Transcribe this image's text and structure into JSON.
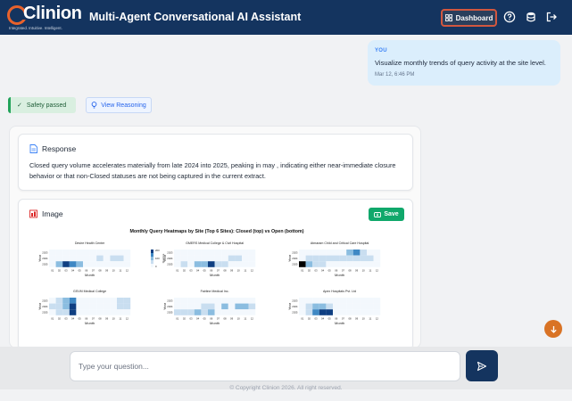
{
  "header": {
    "logo_text": "Clinion",
    "logo_tagline": "Integrated. Intuitive. Intelligent.",
    "title": "Multi-Agent Conversational AI Assistant",
    "dashboard_label": "Dashboard",
    "icons": [
      "help-icon",
      "database-icon",
      "logout-icon"
    ]
  },
  "user_message": {
    "label": "YOU",
    "text": "Visualize monthly trends of query activity at the site level.",
    "timestamp": "Mar 12, 6:46 PM"
  },
  "status": {
    "safety_label": "Safety passed",
    "reasoning_label": "View Reasoning"
  },
  "response": {
    "title": "Response",
    "body": "Closed query volume accelerates materially from late 2024 into 2025, peaking in may , indicating either near-immediate closure behavior or that non-Closed statuses are not being captured in the current extract."
  },
  "image_card": {
    "title": "Image",
    "save_label": "Save"
  },
  "chart_data": {
    "type": "heatmap",
    "title": "Monthly Query Heatmaps by Site (Top 6 Sites): Closed (top) vs Open (bottom)",
    "xlabel": "Month",
    "ylabel": "Year",
    "colorbar_label": "Queries",
    "colorbar_ticks": [
      "200",
      "100",
      "0"
    ],
    "months": [
      "01",
      "02",
      "03",
      "04",
      "05",
      "06",
      "07",
      "08",
      "09",
      "10",
      "11",
      "12"
    ],
    "years": [
      "2023",
      "2024",
      "2025"
    ],
    "panels": [
      {
        "name": "Desire Health Center",
        "values": [
          [
            0,
            0,
            0,
            0,
            0,
            0,
            0,
            0,
            0,
            0,
            0,
            0
          ],
          [
            0,
            0,
            0,
            0,
            0,
            0,
            0,
            1,
            0,
            1,
            1,
            0
          ],
          [
            0,
            2,
            4,
            3,
            2,
            0,
            0,
            0,
            0,
            0,
            0,
            0
          ]
        ]
      },
      {
        "name": "GMERS Medical College & Civil Hospital",
        "values": [
          [
            0,
            0,
            0,
            0,
            0,
            0,
            0,
            0,
            0,
            0,
            0,
            0
          ],
          [
            0,
            0,
            0,
            0,
            0,
            0,
            0,
            0,
            1,
            1,
            0,
            0
          ],
          [
            0,
            1,
            0,
            2,
            2,
            4,
            1,
            1,
            0,
            0,
            0,
            0
          ]
        ]
      },
      {
        "name": "Atmaram Child and Critical Care Hospital",
        "values": [
          [
            0,
            0,
            0,
            0,
            0,
            0,
            0,
            2,
            3,
            1,
            0,
            0
          ],
          [
            0,
            1,
            1,
            1,
            1,
            1,
            1,
            1,
            1,
            1,
            1,
            0
          ],
          [
            5,
            2,
            1,
            1,
            0,
            0,
            0,
            0,
            0,
            0,
            0,
            0
          ]
        ]
      },
      {
        "name": "GSVM Medical College",
        "values": [
          [
            0,
            1,
            2,
            3,
            0,
            0,
            0,
            0,
            0,
            0,
            1,
            1
          ],
          [
            1,
            1,
            2,
            4,
            0,
            0,
            0,
            0,
            0,
            0,
            1,
            1
          ],
          [
            0,
            1,
            1,
            4,
            0,
            0,
            0,
            0,
            0,
            0,
            0,
            0
          ]
        ]
      },
      {
        "name": "Fairline Medical Inc.",
        "values": [
          [
            0,
            0,
            0,
            0,
            0,
            0,
            0,
            0,
            0,
            0,
            0,
            0
          ],
          [
            0,
            0,
            0,
            0,
            1,
            1,
            0,
            2,
            0,
            2,
            2,
            1
          ],
          [
            1,
            1,
            1,
            2,
            1,
            2,
            0,
            0,
            0,
            0,
            0,
            0
          ]
        ]
      },
      {
        "name": "Apex Hospitals Pvt. Ltd",
        "values": [
          [
            0,
            0,
            0,
            0,
            0,
            0,
            0,
            0,
            0,
            0,
            0,
            0
          ],
          [
            0,
            1,
            2,
            2,
            1,
            0,
            0,
            0,
            0,
            0,
            0,
            0
          ],
          [
            0,
            1,
            3,
            4,
            4,
            0,
            0,
            0,
            0,
            0,
            0,
            0
          ]
        ]
      }
    ],
    "colors": [
      "#f3f8fd",
      "#c9def0",
      "#8bbde0",
      "#3f88c4",
      "#0f3f82"
    ]
  },
  "composer": {
    "placeholder": "Type your question..."
  },
  "footer": {
    "text": "© Copyright Clinion 2026. All right reserved."
  }
}
